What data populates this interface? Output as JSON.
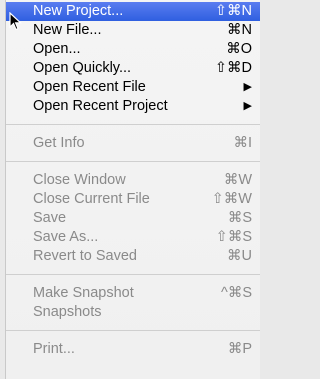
{
  "menu": {
    "groups": [
      [
        {
          "label": "New Project...",
          "shortcut": "⇧⌘N",
          "state": "highlighted"
        },
        {
          "label": "New File...",
          "shortcut": "⌘N"
        },
        {
          "label": "Open...",
          "shortcut": "⌘O"
        },
        {
          "label": "Open Quickly...",
          "shortcut": "⇧⌘D"
        },
        {
          "label": "Open Recent File",
          "shortcut": "▶"
        },
        {
          "label": "Open Recent Project",
          "shortcut": "▶"
        }
      ],
      [
        {
          "label": "Get Info",
          "shortcut": "⌘I",
          "state": "disabled"
        }
      ],
      [
        {
          "label": "Close Window",
          "shortcut": "⌘W",
          "state": "disabled"
        },
        {
          "label": "Close Current File",
          "shortcut": "⇧⌘W",
          "state": "disabled"
        },
        {
          "label": "Save",
          "shortcut": "⌘S",
          "state": "disabled"
        },
        {
          "label": "Save As...",
          "shortcut": "⇧⌘S",
          "state": "disabled"
        },
        {
          "label": "Revert to Saved",
          "shortcut": "⌘U",
          "state": "disabled"
        }
      ],
      [
        {
          "label": "Make Snapshot",
          "shortcut": "^⌘S",
          "state": "disabled"
        },
        {
          "label": "Snapshots",
          "shortcut": "",
          "state": "disabled"
        }
      ],
      [
        {
          "label": "Print...",
          "shortcut": "⌘P",
          "state": "disabled"
        }
      ]
    ]
  },
  "colors": {
    "highlight": "#2f5fe0",
    "disabled_text": "#8a8a8a",
    "enabled_text": "#000000"
  },
  "icons": {
    "cursor": "mouse-pointer-icon",
    "submenu": "submenu-arrow-icon"
  }
}
